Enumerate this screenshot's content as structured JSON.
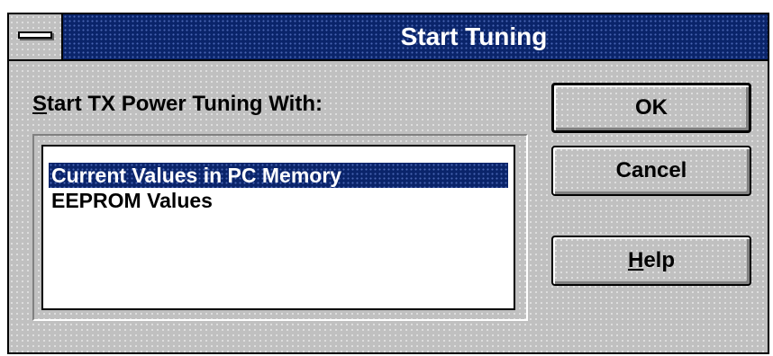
{
  "window": {
    "title": "Start Tuning",
    "system_menu_icon": "minus-bar-icon"
  },
  "prompt": {
    "mnemonic": "S",
    "rest": "tart TX Power Tuning With:"
  },
  "listbox": {
    "items": [
      {
        "label": "Current Values in PC Memory",
        "selected": true
      },
      {
        "label": "EEPROM Values",
        "selected": false
      }
    ]
  },
  "buttons": {
    "ok": "OK",
    "cancel": "Cancel",
    "help_mnemonic": "H",
    "help_rest": "elp"
  },
  "colors": {
    "titlebar": "#0a246a",
    "selection": "#0a246a",
    "dialog_face": "#c0c0c0"
  }
}
